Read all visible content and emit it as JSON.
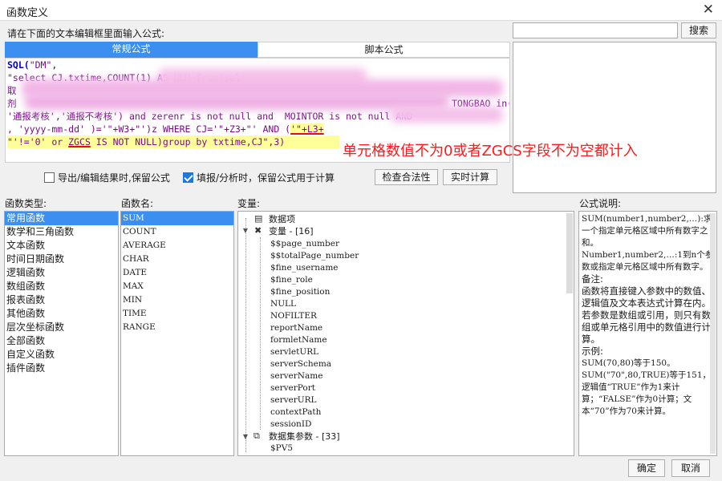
{
  "window": {
    "title": "函数定义"
  },
  "prompt": "请在下面的文本编辑框里面输入公式:",
  "search": {
    "value": "",
    "button": "搜索"
  },
  "tabs": [
    "常规公式",
    "脚本公式"
  ],
  "editor": {
    "line1": [
      "SQL(",
      "\"DM\"",
      ","
    ],
    "line2": "\"select CJ.txtime,COUNT(1) AS NUM from(sel",
    "line3": "取",
    "line4": "剂",
    "line4_end": "TONGBAO in(",
    "line5a": "'通报考核','通报不考核'",
    "line5b": ") and zerenr is not null and  MOINTOR is not null AND ",
    "line6a": ", 'yyyy-mm-dd' )='\"+W3+\"')z WHERE CJ='\"+Z3+\"' AND (",
    "line6b": "'\"+L3+",
    "line7a": "\"'!='0' or ",
    "line7b": "ZGCS",
    "line7c": " IS NOT NULL)group by txtime,CJ\",3)"
  },
  "annotation": "单元格数值不为0或者ZGCS字段不为空都计入",
  "options": {
    "export_keep": {
      "label": "导出/编辑结果时,保留公式",
      "checked": false
    },
    "fill_keep": {
      "label": "填报/分析时，保留公式用于计算",
      "checked": true
    }
  },
  "buttons": {
    "check": "检查合法性",
    "realtime": "实时计算",
    "ok": "确定",
    "cancel": "取消"
  },
  "labels": {
    "fn_type": "函数类型:",
    "fn_name": "函数名:",
    "vars": "变量:",
    "desc": "公式说明:"
  },
  "fn_types": [
    "常用函数",
    "数学和三角函数",
    "文本函数",
    "时间日期函数",
    "逻辑函数",
    "数组函数",
    "报表函数",
    "其他函数",
    "层次坐标函数",
    "全部函数",
    "自定义函数",
    "插件函数"
  ],
  "fn_names": [
    "SUM",
    "COUNT",
    "AVERAGE",
    "CHAR",
    "DATE",
    "MAX",
    "MIN",
    "TIME",
    "RANGE"
  ],
  "vars": {
    "data_item": "数据项",
    "var_group": "变量 - [16]",
    "var_items": [
      "$$page_number",
      "$$totalPage_number",
      "$fine_username",
      "$fine_role",
      "$fine_position",
      "NULL",
      "NOFILTER",
      "reportName",
      "formletName",
      "servletURL",
      "serverSchema",
      "serverName",
      "serverPort",
      "serverURL",
      "contextPath",
      "sessionID"
    ],
    "dataset_group": "数据集参数 - [33]",
    "dataset_first": "$PV5"
  },
  "description": {
    "p1": "SUM(number1,number2,…):求一个指定单元格区域中所有数字之和。",
    "p2": "Number1,number2,…:1到n个参数或指定单元格区域中所有数字。",
    "p3": "备注:",
    "p4": "函数将直接键入参数中的数值、逻辑值及文本表达式计算在内。若参数是数组或引用，则只有数组或单元格引用中的数值进行计算。",
    "p5": "示例:",
    "p6": "SUM(70,80)等于150。",
    "p7": "SUM(\"70\",80,TRUE)等于151，逻辑值“TRUE”作为1来计算；“FALSE”作为0计算；文本“70”作为70来计算。"
  }
}
